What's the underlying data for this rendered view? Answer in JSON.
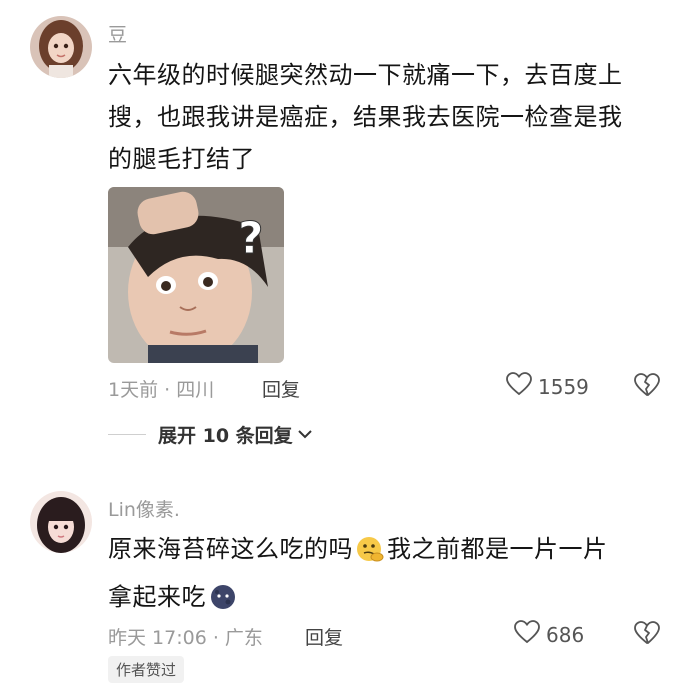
{
  "comments": [
    {
      "username": "豆",
      "text_lines": [
        "六年级的时候腿突然动一下就痛一下，去百度上",
        "搜，也跟我讲是癌症，结果我去医院一检查是我",
        "的腿毛打结了"
      ],
      "meta": "1天前 · 四川",
      "reply_label": "回复",
      "like_count": "1559",
      "expand_label": "展开 10 条回复",
      "image_overlay": "?"
    },
    {
      "username": "Lin像素.",
      "text_part1": "原来海苔碎这么吃的吗",
      "text_part2": "我之前都是一片一片",
      "text_line2": "拿起来吃",
      "meta": "昨天 17:06 · 广东",
      "reply_label": "回复",
      "like_count": "686",
      "badge": "作者赞过"
    }
  ],
  "icons": {
    "like": "heart-outline-icon",
    "dislike": "broken-heart-icon",
    "expand": "chevron-down-icon"
  }
}
